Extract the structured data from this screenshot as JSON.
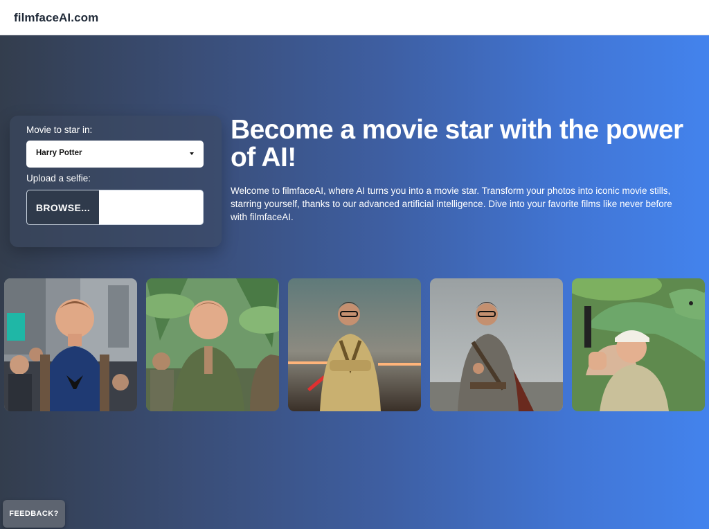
{
  "header": {
    "brand": "filmfaceAI.com"
  },
  "form": {
    "movie_label": "Movie to star in:",
    "movie_selected": "Harry Potter",
    "selfie_label": "Upload a selfie:",
    "browse_label": "BROWSE..."
  },
  "hero": {
    "headline": "Become a movie star with the power of AI!",
    "intro": "Welcome to filmfaceAI, where AI turns you into a movie star. Transform your photos into iconic movie stills, starring yourself, thanks to our advanced artificial intelligence. Dive into your favorite films like never before with filmfaceAI."
  },
  "gallery": [
    {
      "scene": "city-crowd-superhero"
    },
    {
      "scene": "jungle-explorer"
    },
    {
      "scene": "jedi-lightsaber"
    },
    {
      "scene": "armored-knight"
    },
    {
      "scene": "dinosaur-chase"
    }
  ],
  "feedback": {
    "label": "FEEDBACK?"
  },
  "colors": {
    "brand_text": "#1f2937",
    "gradient_start": "#333d4d",
    "gradient_end": "#4383ed",
    "browse_bg": "#2f3a4b"
  }
}
